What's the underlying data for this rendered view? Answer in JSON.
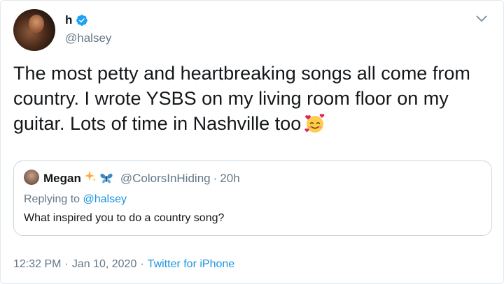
{
  "author": {
    "display_name": "h",
    "handle": "@halsey",
    "verified": true
  },
  "tweet": {
    "text": "The most petty and heartbreaking songs all come from country. I wrote YSBS on my living room floor on my guitar. Lots of time in Nashville too",
    "emoji": "smiling-face-with-hearts"
  },
  "quoted_tweet": {
    "display_name": "Megan",
    "name_emojis": [
      "sparkles",
      "butterfly"
    ],
    "handle": "@ColorsInHiding",
    "separator": "·",
    "time": "20h",
    "replying_prefix": "Replying to",
    "replying_handle": "@halsey",
    "text": "What inspired you to do a country song?"
  },
  "meta": {
    "time": "12:32 PM",
    "separator": "·",
    "date": "Jan 10, 2020",
    "source": "Twitter for iPhone"
  },
  "colors": {
    "link": "#1b95e0",
    "secondary_text": "#657786",
    "verified": "#1da1f2",
    "border": "#ccd6dd"
  }
}
